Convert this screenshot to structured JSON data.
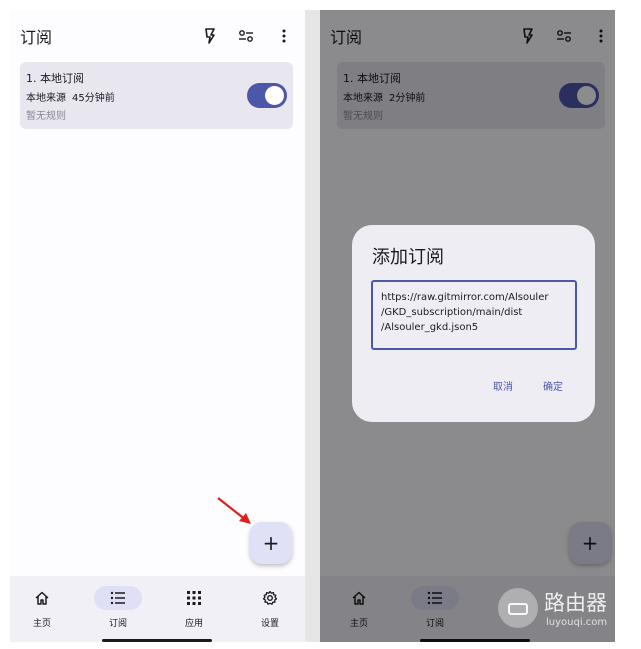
{
  "colors": {
    "accent": "#4d57a9",
    "surface": "#fdfcff",
    "card": "#e8e6ef",
    "nav_bar": "#f1f0f7",
    "nav_active_pill": "#dfe0f5",
    "fab": "#e0e1f7",
    "annotation_arrow": "#e02020"
  },
  "left": {
    "header": {
      "title": "订阅",
      "icons": [
        "flash-icon",
        "filter-sliders-icon",
        "more-vertical-icon"
      ]
    },
    "subscription": {
      "name": "1. 本地订阅",
      "source": "本地来源",
      "updated": "45分钟前",
      "rules": "暂无规则",
      "enabled": true
    },
    "fab_icon": "+",
    "nav": [
      {
        "label": "主页",
        "icon": "home-icon",
        "active": false
      },
      {
        "label": "订阅",
        "icon": "list-icon",
        "active": true
      },
      {
        "label": "应用",
        "icon": "grid-icon",
        "active": false
      },
      {
        "label": "设置",
        "icon": "gear-icon",
        "active": false
      }
    ]
  },
  "right": {
    "header": {
      "title": "订阅",
      "icons": [
        "flash-icon",
        "filter-sliders-icon",
        "more-vertical-icon"
      ]
    },
    "subscription": {
      "name": "1. 本地订阅",
      "source": "本地来源",
      "updated": "2分钟前",
      "rules": "暂无规则",
      "enabled": true
    },
    "fab_icon": "+",
    "nav": [
      {
        "label": "主页",
        "icon": "home-icon",
        "active": false
      },
      {
        "label": "订阅",
        "icon": "list-icon",
        "active": true
      }
    ],
    "dialog": {
      "title": "添加订阅",
      "input_value": "https://raw.gitmirror.com/Alsouler\n/GKD_subscription/main/dist\n/Alsouler_gkd.json5",
      "cancel_label": "取消",
      "confirm_label": "确定"
    },
    "watermark": {
      "text": "路由器",
      "subtext": "luyouqi.com"
    }
  }
}
